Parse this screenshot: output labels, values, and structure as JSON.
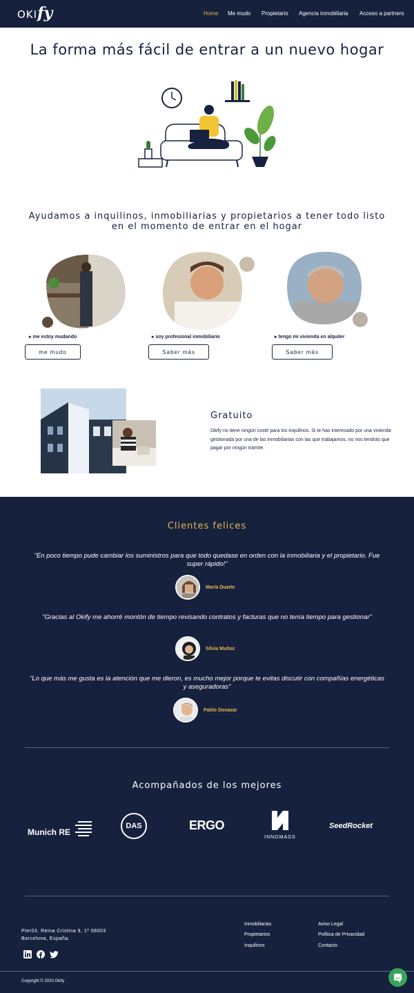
{
  "brand": {
    "logo_text": "OKI",
    "logo_script": "fy"
  },
  "nav": [
    {
      "label": "Home",
      "active": true
    },
    {
      "label": "Me mudo",
      "active": false
    },
    {
      "label": "Propietario",
      "active": false
    },
    {
      "label": "Agencia inmobiliaria",
      "active": false
    },
    {
      "label": "Acceso a partners",
      "active": false
    }
  ],
  "hero": {
    "title": "La forma más fácil de entrar a un nuevo hogar"
  },
  "intro": {
    "subtitle": "Ayudamos a inquilinos, inmobiliarias y propietarios a tener todo listo en el momento de entrar en el hogar"
  },
  "profiles": [
    {
      "caption": "me estoy mudando",
      "button": "me mudo"
    },
    {
      "caption": "soy profesional inmobiliario",
      "button": "Saber más"
    },
    {
      "caption": "tengo mi vivienda en alquiler",
      "button": "Saber más"
    }
  ],
  "gratuito": {
    "title": "Gratuito",
    "text": "Okify no tiene ningún coste para los inquilinos. Si te has interesado por una vivienda gestionada por una de las inmobiliarias con las que trabajamos, no nos tendrás que pagar por ningún trámite."
  },
  "testimonials": {
    "title": "Clientes felices",
    "items": [
      {
        "quote": "\"En poco tiempo pude cambiar los suministros para que todo quedase en orden con la inmobiliaria y el propietario. Fue super rápido!\"",
        "name": "María Duarte"
      },
      {
        "quote": "\"Gracias al Okify me ahorré montón de tiempo revisando contratos y facturas que no tenía tiempo para gestionar\"",
        "name": "Silvia Muñoz"
      },
      {
        "quote": "\"Lo que más me gusta es la atención que me dieron, es mucho mejor porque te evitas discutir con compañías energéticas y aseguradoras\"",
        "name": "Pablo Donazar"
      }
    ]
  },
  "partners": {
    "title": "Acompañados de los mejores",
    "logos": [
      "Munich RE",
      "DAS",
      "ERGO",
      "INNOMADS",
      "SeedRocket"
    ]
  },
  "footer": {
    "address_line1": "Pier03. Reina Cristina 9, 1º 08003",
    "address_line2": "Barcelona, España.",
    "links_col1": [
      "Inmobiliarias",
      "Propietarios",
      "Inquilinos"
    ],
    "links_col2": [
      "Aviso Legal",
      "Política de Privacidad",
      "Contacto"
    ],
    "social": [
      "linkedin-icon",
      "facebook-icon",
      "twitter-icon"
    ],
    "copyright": "Copyright © 2020 Okify"
  },
  "colors": {
    "navy": "#16213e",
    "accent": "#e8b84c",
    "chat": "#3aa45b"
  }
}
